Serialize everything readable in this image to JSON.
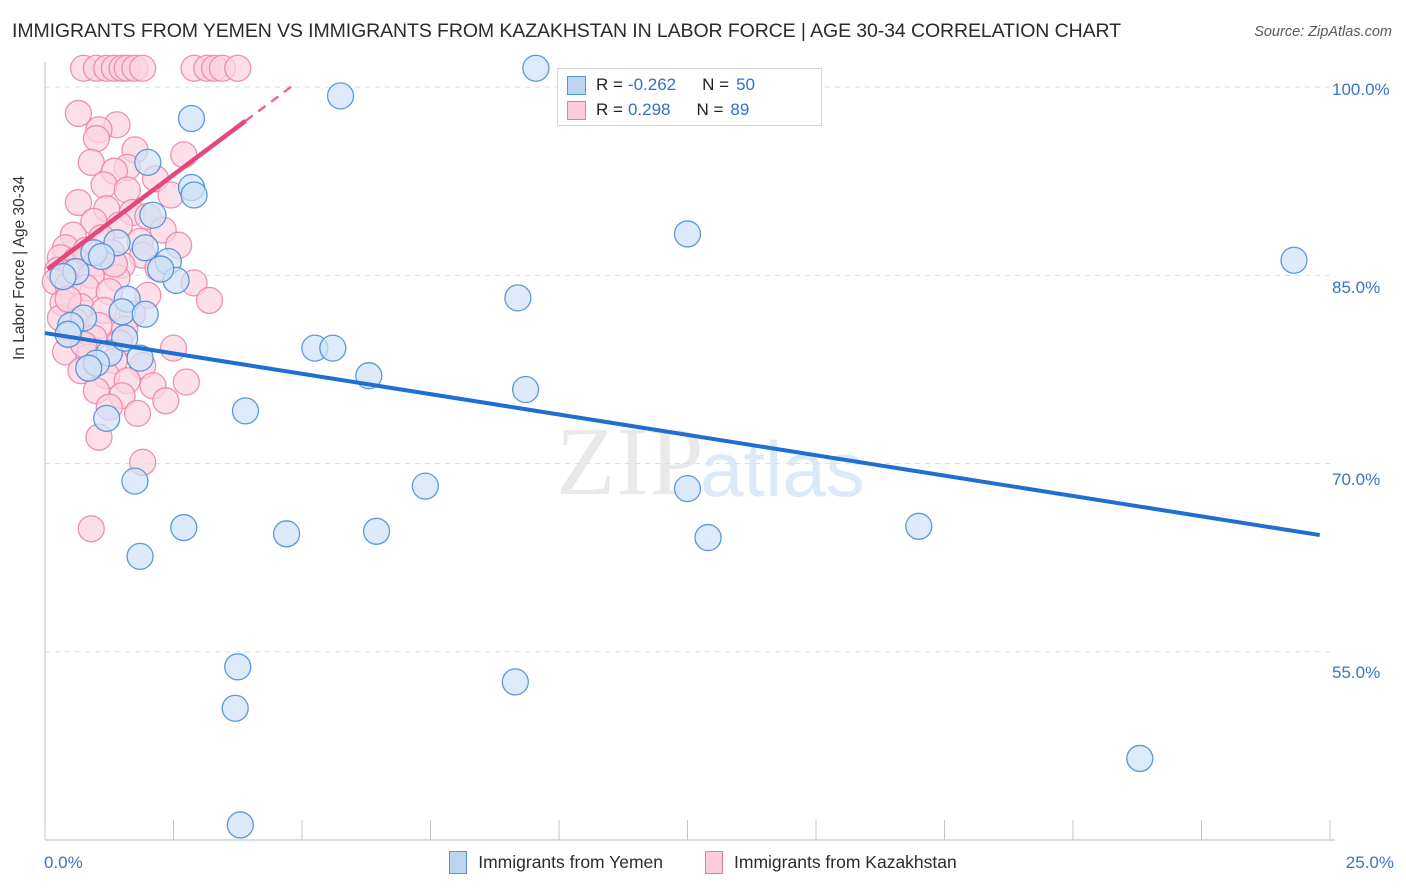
{
  "header": {
    "title": "IMMIGRANTS FROM YEMEN VS IMMIGRANTS FROM KAZAKHSTAN IN LABOR FORCE | AGE 30-34 CORRELATION CHART",
    "source": "Source: ZipAtlas.com"
  },
  "watermark": {
    "part1": "ZIP",
    "part2": "atlas"
  },
  "stats": {
    "blue": {
      "r_label": "R =",
      "r_value": "-0.262",
      "n_label": "N =",
      "n_value": "50"
    },
    "pink": {
      "r_label": "R =",
      "r_value": "0.298",
      "n_label": "N =",
      "n_value": "89"
    }
  },
  "legend": {
    "series1": "Immigrants from Yemen",
    "series2": "Immigrants from Kazakhstan"
  },
  "chart_data": {
    "type": "scatter",
    "title": "IMMIGRANTS FROM YEMEN VS IMMIGRANTS FROM KAZAKHSTAN IN LABOR FORCE | AGE 30-34 CORRELATION CHART",
    "xlabel": "",
    "ylabel": "In Labor Force | Age 30-34",
    "xlim": [
      0.0,
      25.0
    ],
    "ylim": [
      40.0,
      102.0
    ],
    "x_tick_labels": [
      "0.0%",
      "25.0%"
    ],
    "y_tick_labels": [
      "100.0%",
      "85.0%",
      "70.0%",
      "55.0%"
    ],
    "y_ticks": [
      100.0,
      85.0,
      70.0,
      55.0
    ],
    "grid": "horizontal-dashed",
    "legend_position": "bottom-center",
    "colors": {
      "series1_fill": "#cfe2f7",
      "series1_stroke": "#4a8fd4",
      "series2_fill": "#fbd2e0",
      "series2_stroke": "#ec7fa6",
      "trend1": "#1f6fd0",
      "trend2": "#e4477c",
      "tick_text": "#3a74c4"
    },
    "series": [
      {
        "name": "Immigrants from Yemen",
        "r": -0.262,
        "n": 50,
        "trendline": {
          "x0": 0.0,
          "y0": 80.4,
          "x1": 24.8,
          "y1": 64.3,
          "style": "solid"
        },
        "points": [
          [
            9.55,
            101.5
          ],
          [
            5.75,
            99.3
          ],
          [
            2.85,
            97.5
          ],
          [
            2.0,
            94.0
          ],
          [
            2.85,
            92.0
          ],
          [
            2.9,
            91.4
          ],
          [
            2.1,
            89.8
          ],
          [
            12.5,
            88.3
          ],
          [
            1.4,
            87.6
          ],
          [
            1.95,
            87.2
          ],
          [
            24.3,
            86.2
          ],
          [
            0.95,
            86.8
          ],
          [
            2.4,
            86.1
          ],
          [
            0.6,
            85.3
          ],
          [
            2.55,
            84.6
          ],
          [
            9.2,
            83.2
          ],
          [
            0.35,
            84.9
          ],
          [
            1.6,
            83.1
          ],
          [
            1.5,
            82.1
          ],
          [
            1.95,
            81.9
          ],
          [
            0.75,
            81.6
          ],
          [
            0.5,
            81.0
          ],
          [
            5.25,
            79.2
          ],
          [
            5.6,
            79.2
          ],
          [
            1.25,
            78.8
          ],
          [
            1.85,
            78.4
          ],
          [
            1.0,
            78.0
          ],
          [
            0.85,
            77.6
          ],
          [
            6.3,
            77.0
          ],
          [
            9.35,
            75.9
          ],
          [
            3.9,
            74.2
          ],
          [
            1.2,
            73.6
          ],
          [
            0.45,
            80.3
          ],
          [
            1.55,
            80.0
          ],
          [
            12.5,
            68.0
          ],
          [
            7.4,
            68.2
          ],
          [
            1.75,
            68.6
          ],
          [
            2.7,
            64.9
          ],
          [
            4.7,
            64.4
          ],
          [
            6.45,
            64.6
          ],
          [
            12.9,
            64.1
          ],
          [
            17.0,
            65.0
          ],
          [
            1.85,
            62.6
          ],
          [
            3.75,
            53.8
          ],
          [
            9.15,
            52.6
          ],
          [
            3.7,
            50.5
          ],
          [
            21.3,
            46.5
          ],
          [
            3.8,
            41.2
          ],
          [
            1.1,
            86.5
          ],
          [
            2.25,
            85.5
          ]
        ]
      },
      {
        "name": "Immigrants from Kazakhstan",
        "r": 0.298,
        "n": 89,
        "trendline": {
          "x0": 0.05,
          "y0": 85.5,
          "x1": 3.9,
          "y1": 97.3,
          "style": "solid-then-dashed",
          "dash_from_x": 3.95,
          "dash_to_x": 4.9,
          "dash_to_y": 100.6
        },
        "points": [
          [
            0.75,
            101.5
          ],
          [
            1.0,
            101.5
          ],
          [
            1.2,
            101.5
          ],
          [
            1.35,
            101.5
          ],
          [
            1.5,
            101.5
          ],
          [
            1.6,
            101.5
          ],
          [
            1.75,
            101.5
          ],
          [
            1.9,
            101.5
          ],
          [
            2.9,
            101.5
          ],
          [
            3.15,
            101.5
          ],
          [
            3.3,
            101.5
          ],
          [
            3.45,
            101.5
          ],
          [
            3.75,
            101.5
          ],
          [
            0.65,
            97.9
          ],
          [
            1.4,
            97.0
          ],
          [
            1.05,
            96.6
          ],
          [
            1.0,
            95.9
          ],
          [
            1.75,
            95.0
          ],
          [
            2.7,
            94.6
          ],
          [
            0.9,
            94.0
          ],
          [
            1.6,
            93.6
          ],
          [
            1.35,
            93.3
          ],
          [
            2.15,
            92.7
          ],
          [
            1.15,
            92.2
          ],
          [
            1.6,
            91.8
          ],
          [
            2.45,
            91.4
          ],
          [
            0.65,
            90.8
          ],
          [
            1.2,
            90.3
          ],
          [
            1.7,
            90.0
          ],
          [
            2.0,
            89.7
          ],
          [
            0.95,
            89.3
          ],
          [
            1.45,
            89.0
          ],
          [
            2.3,
            88.6
          ],
          [
            0.55,
            88.2
          ],
          [
            1.1,
            88.0
          ],
          [
            1.85,
            87.7
          ],
          [
            2.6,
            87.4
          ],
          [
            0.4,
            87.2
          ],
          [
            0.8,
            87.0
          ],
          [
            1.3,
            86.8
          ],
          [
            1.9,
            86.6
          ],
          [
            0.3,
            86.4
          ],
          [
            0.6,
            86.2
          ],
          [
            1.0,
            86.0
          ],
          [
            1.5,
            85.8
          ],
          [
            2.2,
            85.6
          ],
          [
            0.25,
            85.4
          ],
          [
            0.5,
            85.2
          ],
          [
            0.9,
            85.0
          ],
          [
            1.4,
            84.8
          ],
          [
            2.9,
            84.4
          ],
          [
            0.2,
            84.5
          ],
          [
            0.45,
            84.2
          ],
          [
            0.8,
            84.0
          ],
          [
            1.25,
            83.7
          ],
          [
            2.0,
            83.4
          ],
          [
            3.2,
            83.0
          ],
          [
            0.35,
            82.8
          ],
          [
            0.7,
            82.5
          ],
          [
            1.15,
            82.2
          ],
          [
            1.7,
            81.9
          ],
          [
            0.3,
            81.6
          ],
          [
            0.6,
            81.3
          ],
          [
            1.05,
            81.0
          ],
          [
            1.55,
            80.7
          ],
          [
            0.5,
            80.3
          ],
          [
            0.95,
            80.0
          ],
          [
            1.45,
            79.6
          ],
          [
            2.5,
            79.2
          ],
          [
            0.4,
            78.9
          ],
          [
            0.85,
            78.5
          ],
          [
            1.35,
            78.2
          ],
          [
            1.9,
            77.8
          ],
          [
            0.7,
            77.4
          ],
          [
            1.2,
            77.0
          ],
          [
            1.6,
            76.6
          ],
          [
            2.1,
            76.2
          ],
          [
            1.0,
            75.8
          ],
          [
            1.5,
            75.4
          ],
          [
            2.35,
            75.0
          ],
          [
            1.25,
            74.5
          ],
          [
            1.8,
            74.0
          ],
          [
            1.05,
            72.1
          ],
          [
            1.9,
            70.1
          ],
          [
            0.9,
            64.8
          ],
          [
            0.45,
            83.1
          ],
          [
            0.75,
            79.5
          ],
          [
            2.75,
            76.5
          ],
          [
            1.35,
            85.9
          ]
        ]
      }
    ]
  }
}
